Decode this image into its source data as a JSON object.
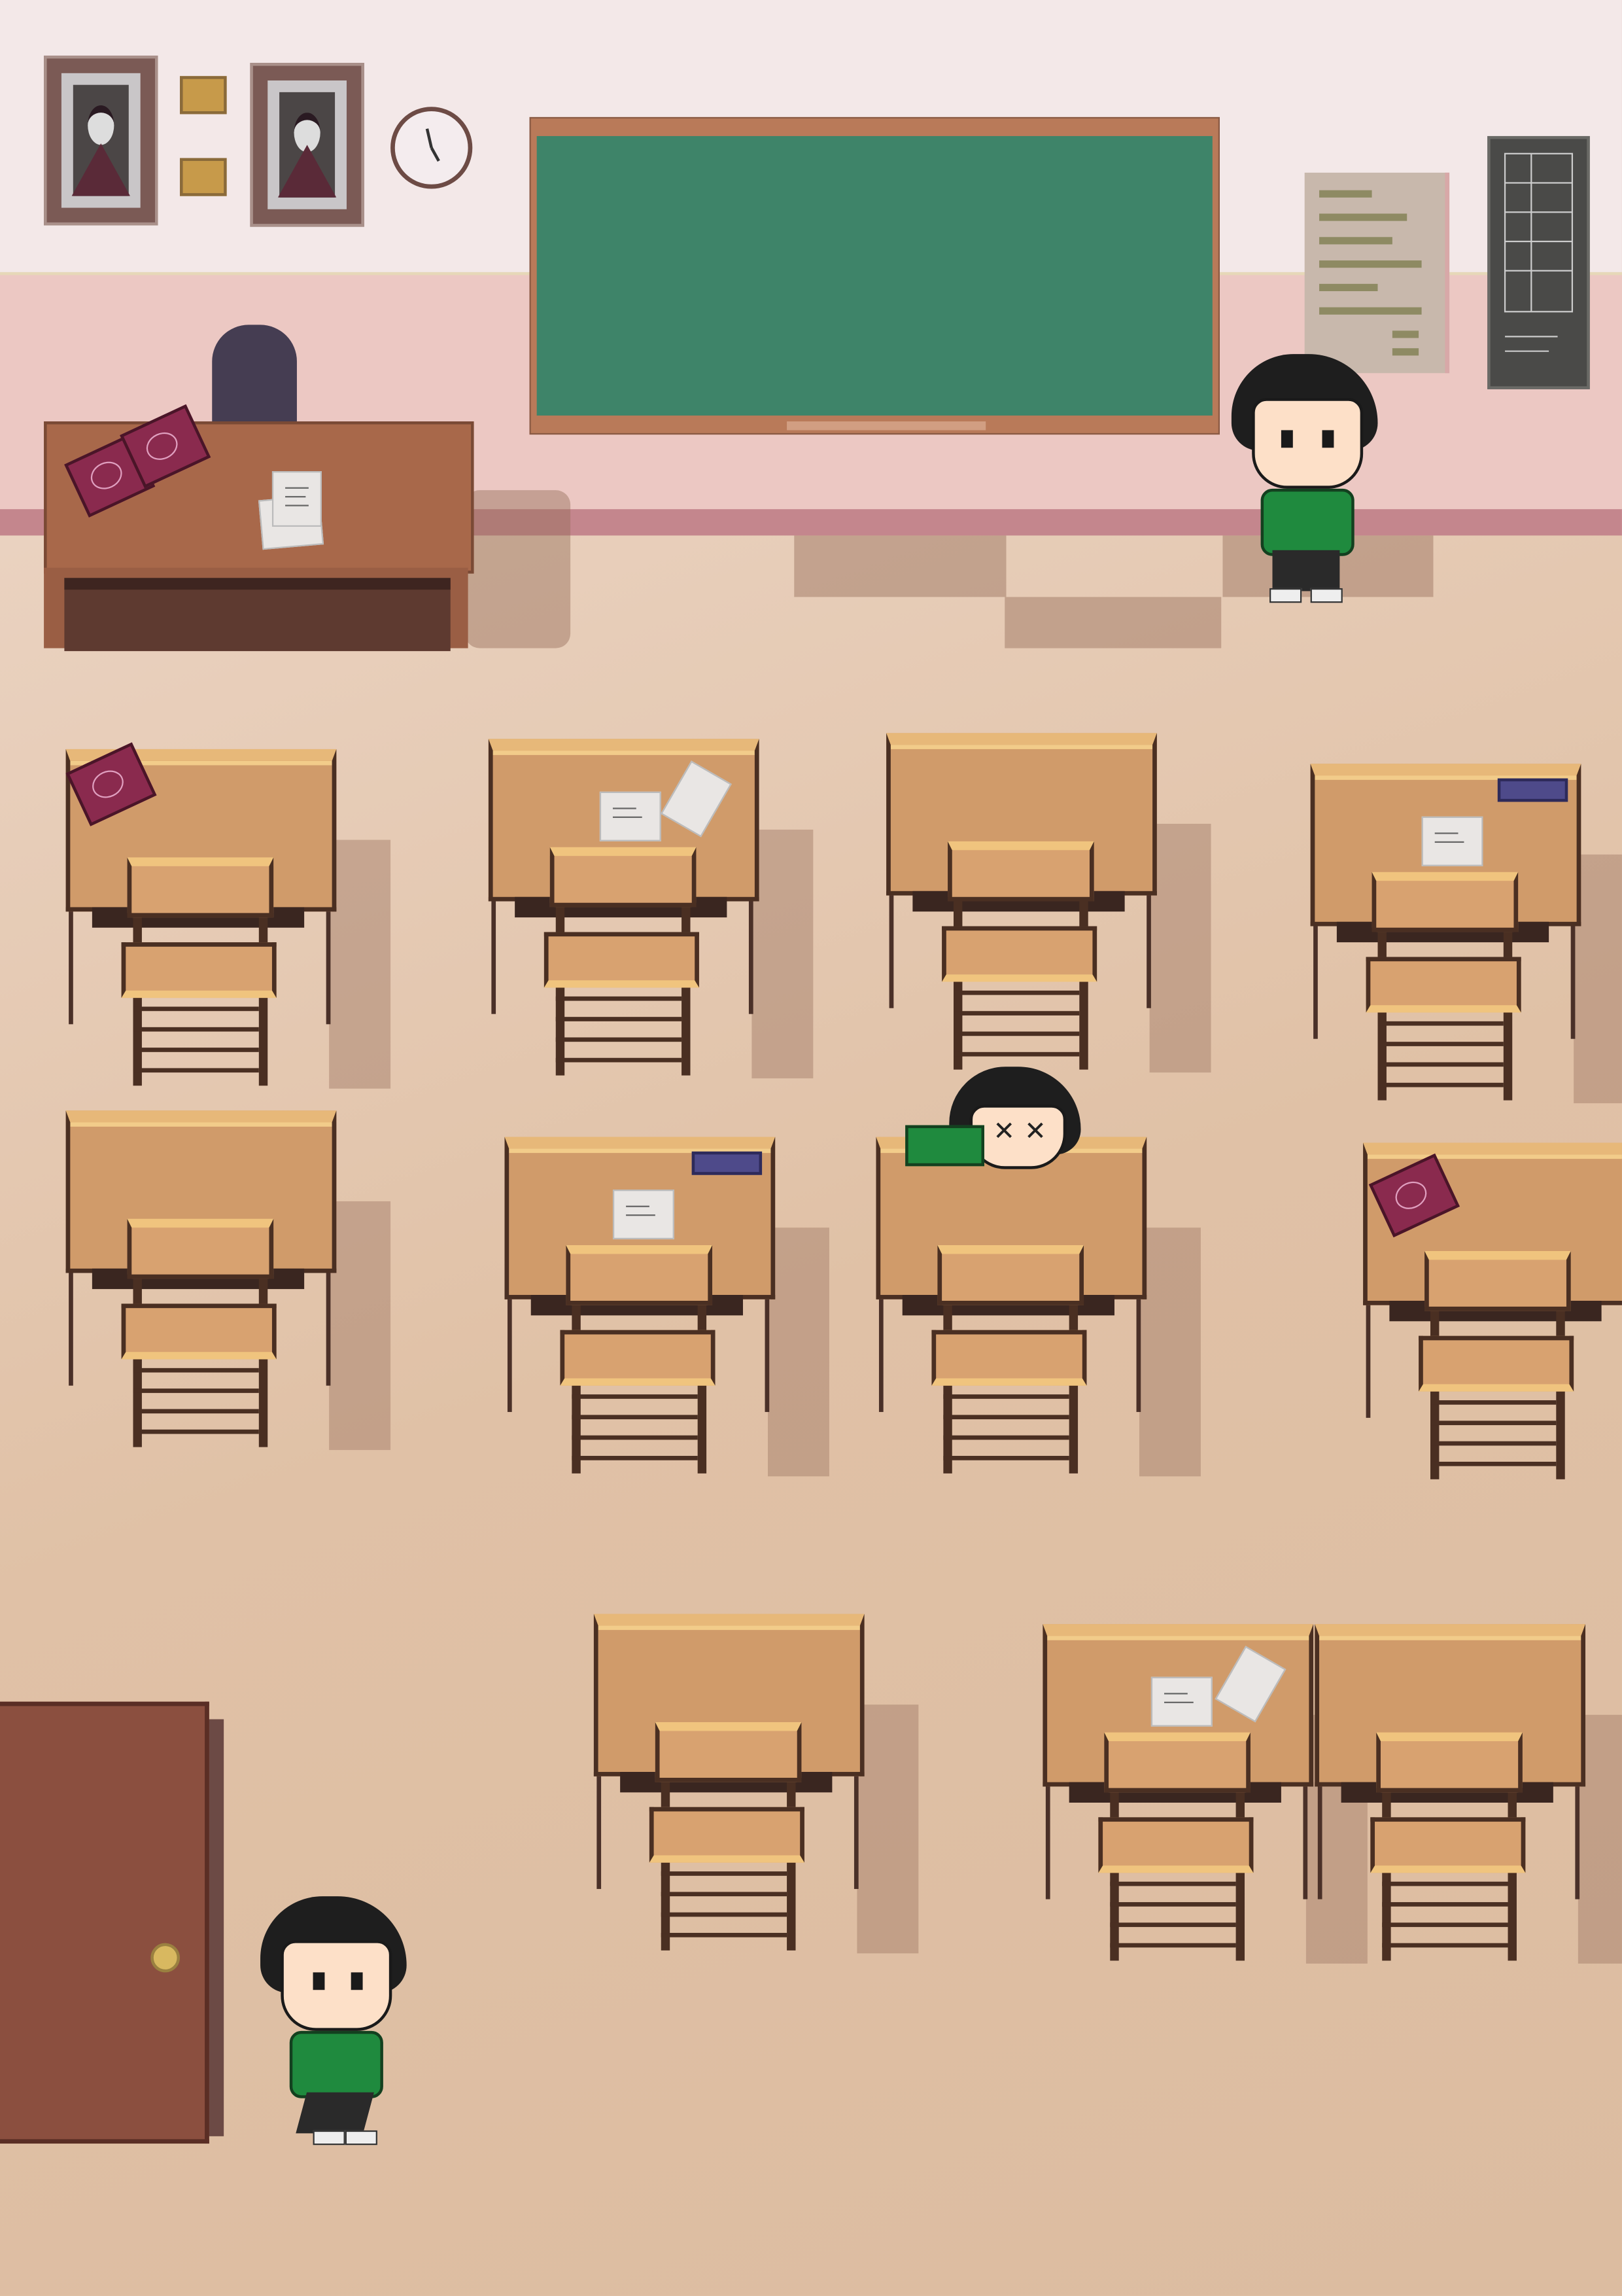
{
  "scene": {
    "type": "pixel-art classroom",
    "colors": {
      "wall": "#f3e8e8",
      "wainscot": "#ecc8c3",
      "baseboard": "#c4868d",
      "floor": "#e2c3a9",
      "chalkboard": "#3e8469",
      "desk": "#d09b6a",
      "door": "#8b4f3f",
      "uniform": "#1f8a3e"
    },
    "wall_items": [
      "portrait-left",
      "plaque-top",
      "plaque-bottom",
      "portrait-right",
      "wall-clock",
      "chalkboard",
      "notice-poster",
      "schedule-board"
    ],
    "teacher_desk": {
      "items": [
        "book-stack",
        "paper-sheets"
      ]
    },
    "student_desks": [
      {
        "items": [
          "book-stack"
        ]
      },
      {
        "items": [
          "paper",
          "tilted-paper"
        ]
      },
      {
        "items": []
      },
      {
        "items": [
          "blue-book",
          "paper"
        ]
      },
      {
        "items": []
      },
      {
        "items": [
          "blue-book",
          "paper"
        ]
      },
      {
        "items": [
          "sleeping-student"
        ]
      },
      {
        "items": [
          "red-book"
        ]
      },
      {
        "items": []
      },
      {
        "items": [
          "paper",
          "tilted-paper"
        ]
      },
      {
        "items": []
      }
    ],
    "characters": [
      "student-standing-front",
      "student-sleeping-on-desk",
      "student-walking-in-door"
    ]
  }
}
